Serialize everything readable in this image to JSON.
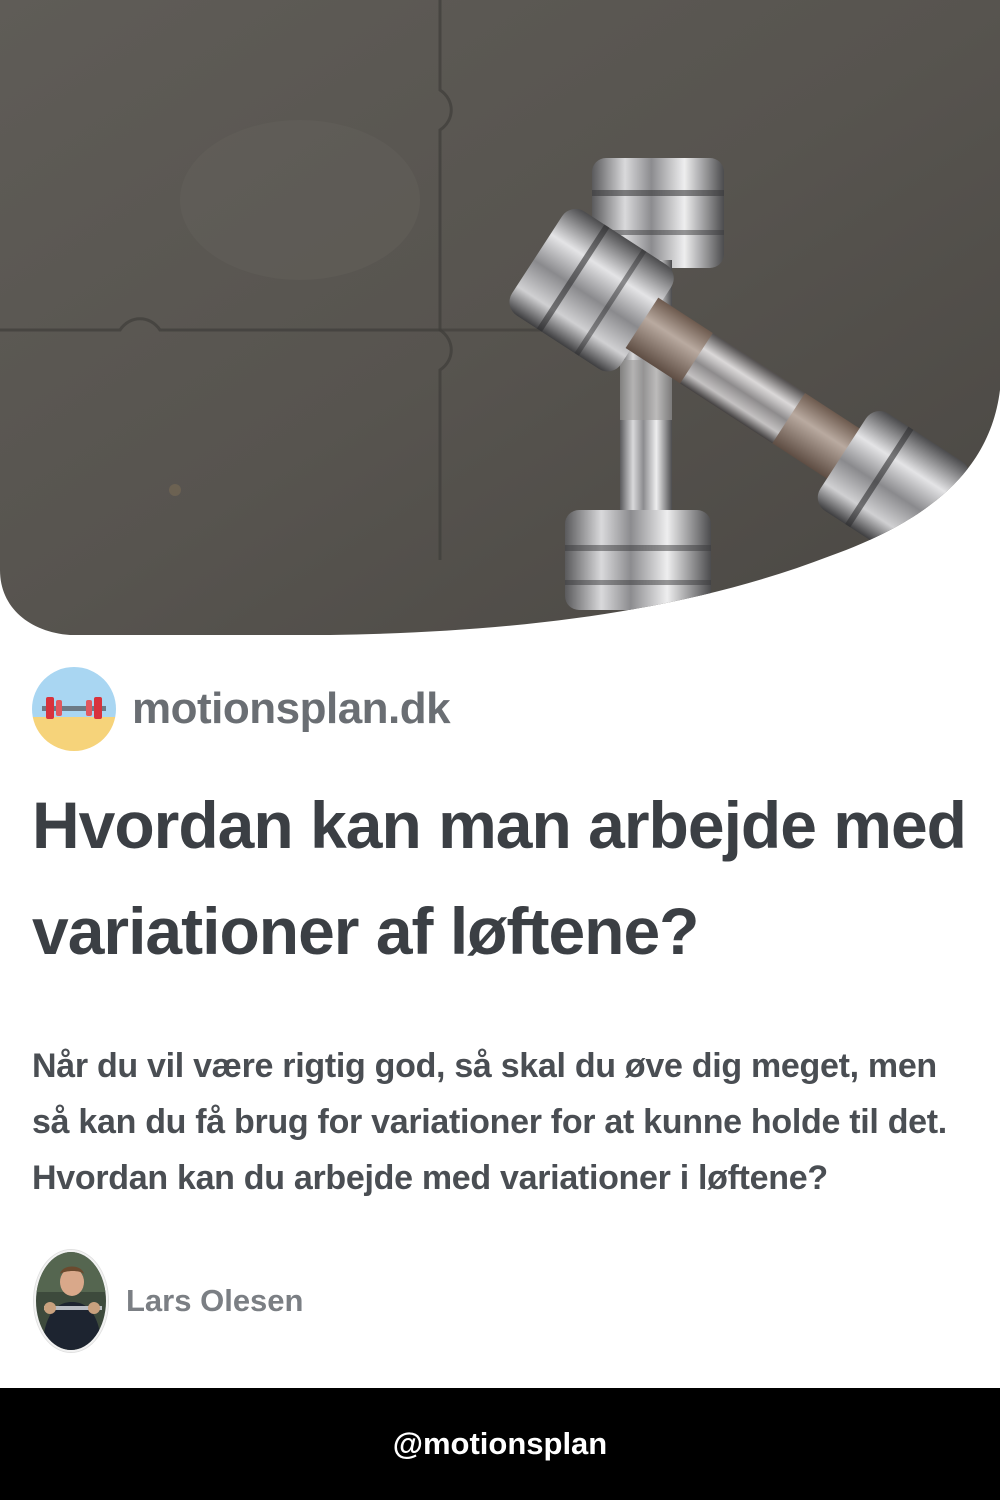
{
  "hero": {
    "image": "dumbbells-on-gym-floor"
  },
  "brand": {
    "logo_icon": "barbell-beach-icon",
    "name": "motionsplan.dk"
  },
  "article": {
    "title": "Hvordan kan man arbejde med variationer af løftene?",
    "description": "Når du vil være rigtig god, så skal du øve dig meget, men så kan du få brug for variationer for at kunne holde til det. Hvordan kan du arbejde med variationer i løftene?"
  },
  "author": {
    "name": "Lars Olesen"
  },
  "footer": {
    "handle": "@motionsplan"
  },
  "colors": {
    "title": "#3b3f44",
    "brand": "#6a6e73",
    "footer_bg": "#000000"
  }
}
